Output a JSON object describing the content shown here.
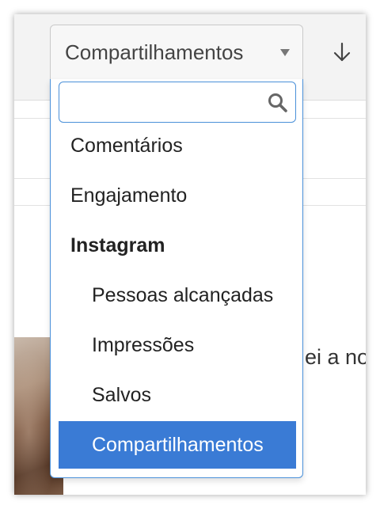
{
  "select": {
    "value": "Compartilhamentos",
    "search_placeholder": "",
    "options": [
      {
        "label": "Comentários"
      },
      {
        "label": "Engajamento"
      },
      {
        "label": "Instagram"
      },
      {
        "label": "Pessoas alcançadas"
      },
      {
        "label": "Impressões"
      },
      {
        "label": "Salvos"
      },
      {
        "label": "Compartilhamentos"
      }
    ]
  },
  "background": {
    "partial_text": "ei a no"
  },
  "colors": {
    "accent": "#3a7bd5",
    "focus_border": "#4a90d9"
  }
}
